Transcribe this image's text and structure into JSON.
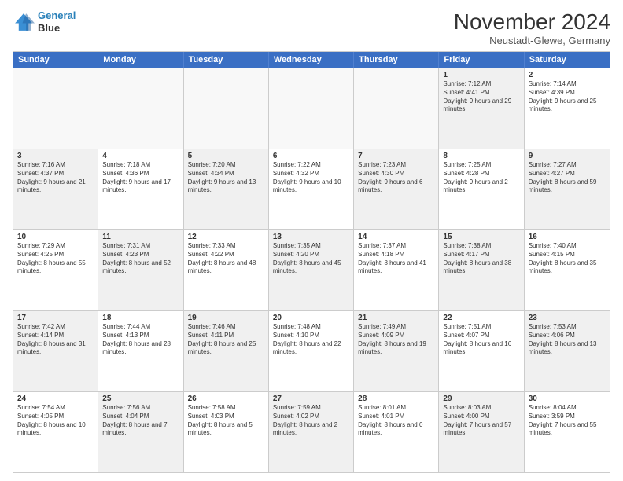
{
  "header": {
    "logo_line1": "General",
    "logo_line2": "Blue",
    "month_title": "November 2024",
    "location": "Neustadt-Glewe, Germany"
  },
  "days_of_week": [
    "Sunday",
    "Monday",
    "Tuesday",
    "Wednesday",
    "Thursday",
    "Friday",
    "Saturday"
  ],
  "rows": [
    {
      "cells": [
        {
          "day": "",
          "info": "",
          "empty": true
        },
        {
          "day": "",
          "info": "",
          "empty": true
        },
        {
          "day": "",
          "info": "",
          "empty": true
        },
        {
          "day": "",
          "info": "",
          "empty": true
        },
        {
          "day": "",
          "info": "",
          "empty": true
        },
        {
          "day": "1",
          "info": "Sunrise: 7:12 AM\nSunset: 4:41 PM\nDaylight: 9 hours and 29 minutes.",
          "shaded": true
        },
        {
          "day": "2",
          "info": "Sunrise: 7:14 AM\nSunset: 4:39 PM\nDaylight: 9 hours and 25 minutes.",
          "shaded": false
        }
      ]
    },
    {
      "cells": [
        {
          "day": "3",
          "info": "Sunrise: 7:16 AM\nSunset: 4:37 PM\nDaylight: 9 hours and 21 minutes.",
          "shaded": true
        },
        {
          "day": "4",
          "info": "Sunrise: 7:18 AM\nSunset: 4:36 PM\nDaylight: 9 hours and 17 minutes.",
          "shaded": false
        },
        {
          "day": "5",
          "info": "Sunrise: 7:20 AM\nSunset: 4:34 PM\nDaylight: 9 hours and 13 minutes.",
          "shaded": true
        },
        {
          "day": "6",
          "info": "Sunrise: 7:22 AM\nSunset: 4:32 PM\nDaylight: 9 hours and 10 minutes.",
          "shaded": false
        },
        {
          "day": "7",
          "info": "Sunrise: 7:23 AM\nSunset: 4:30 PM\nDaylight: 9 hours and 6 minutes.",
          "shaded": true
        },
        {
          "day": "8",
          "info": "Sunrise: 7:25 AM\nSunset: 4:28 PM\nDaylight: 9 hours and 2 minutes.",
          "shaded": false
        },
        {
          "day": "9",
          "info": "Sunrise: 7:27 AM\nSunset: 4:27 PM\nDaylight: 8 hours and 59 minutes.",
          "shaded": true
        }
      ]
    },
    {
      "cells": [
        {
          "day": "10",
          "info": "Sunrise: 7:29 AM\nSunset: 4:25 PM\nDaylight: 8 hours and 55 minutes.",
          "shaded": false
        },
        {
          "day": "11",
          "info": "Sunrise: 7:31 AM\nSunset: 4:23 PM\nDaylight: 8 hours and 52 minutes.",
          "shaded": true
        },
        {
          "day": "12",
          "info": "Sunrise: 7:33 AM\nSunset: 4:22 PM\nDaylight: 8 hours and 48 minutes.",
          "shaded": false
        },
        {
          "day": "13",
          "info": "Sunrise: 7:35 AM\nSunset: 4:20 PM\nDaylight: 8 hours and 45 minutes.",
          "shaded": true
        },
        {
          "day": "14",
          "info": "Sunrise: 7:37 AM\nSunset: 4:18 PM\nDaylight: 8 hours and 41 minutes.",
          "shaded": false
        },
        {
          "day": "15",
          "info": "Sunrise: 7:38 AM\nSunset: 4:17 PM\nDaylight: 8 hours and 38 minutes.",
          "shaded": true
        },
        {
          "day": "16",
          "info": "Sunrise: 7:40 AM\nSunset: 4:15 PM\nDaylight: 8 hours and 35 minutes.",
          "shaded": false
        }
      ]
    },
    {
      "cells": [
        {
          "day": "17",
          "info": "Sunrise: 7:42 AM\nSunset: 4:14 PM\nDaylight: 8 hours and 31 minutes.",
          "shaded": true
        },
        {
          "day": "18",
          "info": "Sunrise: 7:44 AM\nSunset: 4:13 PM\nDaylight: 8 hours and 28 minutes.",
          "shaded": false
        },
        {
          "day": "19",
          "info": "Sunrise: 7:46 AM\nSunset: 4:11 PM\nDaylight: 8 hours and 25 minutes.",
          "shaded": true
        },
        {
          "day": "20",
          "info": "Sunrise: 7:48 AM\nSunset: 4:10 PM\nDaylight: 8 hours and 22 minutes.",
          "shaded": false
        },
        {
          "day": "21",
          "info": "Sunrise: 7:49 AM\nSunset: 4:09 PM\nDaylight: 8 hours and 19 minutes.",
          "shaded": true
        },
        {
          "day": "22",
          "info": "Sunrise: 7:51 AM\nSunset: 4:07 PM\nDaylight: 8 hours and 16 minutes.",
          "shaded": false
        },
        {
          "day": "23",
          "info": "Sunrise: 7:53 AM\nSunset: 4:06 PM\nDaylight: 8 hours and 13 minutes.",
          "shaded": true
        }
      ]
    },
    {
      "cells": [
        {
          "day": "24",
          "info": "Sunrise: 7:54 AM\nSunset: 4:05 PM\nDaylight: 8 hours and 10 minutes.",
          "shaded": false
        },
        {
          "day": "25",
          "info": "Sunrise: 7:56 AM\nSunset: 4:04 PM\nDaylight: 8 hours and 7 minutes.",
          "shaded": true
        },
        {
          "day": "26",
          "info": "Sunrise: 7:58 AM\nSunset: 4:03 PM\nDaylight: 8 hours and 5 minutes.",
          "shaded": false
        },
        {
          "day": "27",
          "info": "Sunrise: 7:59 AM\nSunset: 4:02 PM\nDaylight: 8 hours and 2 minutes.",
          "shaded": true
        },
        {
          "day": "28",
          "info": "Sunrise: 8:01 AM\nSunset: 4:01 PM\nDaylight: 8 hours and 0 minutes.",
          "shaded": false
        },
        {
          "day": "29",
          "info": "Sunrise: 8:03 AM\nSunset: 4:00 PM\nDaylight: 7 hours and 57 minutes.",
          "shaded": true
        },
        {
          "day": "30",
          "info": "Sunrise: 8:04 AM\nSunset: 3:59 PM\nDaylight: 7 hours and 55 minutes.",
          "shaded": false
        }
      ]
    }
  ]
}
